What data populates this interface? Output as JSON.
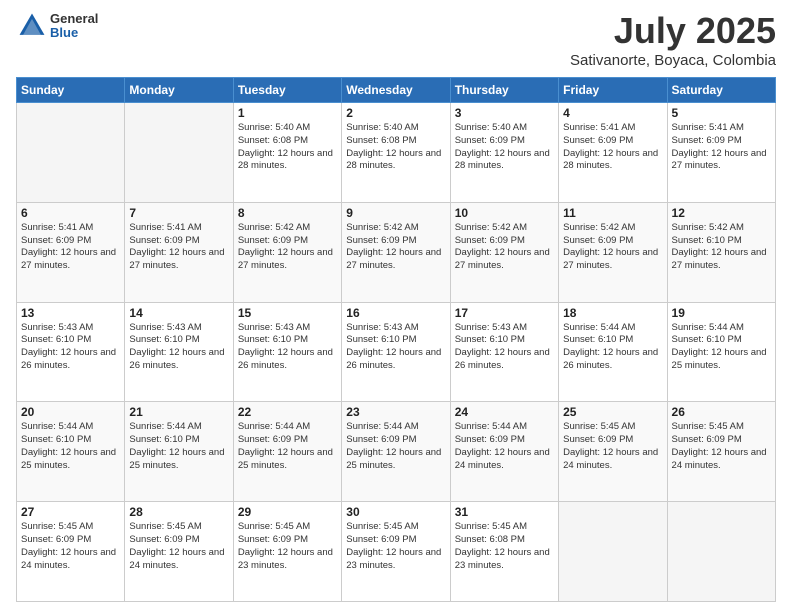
{
  "header": {
    "logo": {
      "general": "General",
      "blue": "Blue"
    },
    "title": "July 2025",
    "subtitle": "Sativanorte, Boyaca, Colombia"
  },
  "weekdays": [
    "Sunday",
    "Monday",
    "Tuesday",
    "Wednesday",
    "Thursday",
    "Friday",
    "Saturday"
  ],
  "weeks": [
    [
      {
        "day": "",
        "empty": true
      },
      {
        "day": "",
        "empty": true
      },
      {
        "day": "1",
        "sunrise": "Sunrise: 5:40 AM",
        "sunset": "Sunset: 6:08 PM",
        "daylight": "Daylight: 12 hours and 28 minutes."
      },
      {
        "day": "2",
        "sunrise": "Sunrise: 5:40 AM",
        "sunset": "Sunset: 6:08 PM",
        "daylight": "Daylight: 12 hours and 28 minutes."
      },
      {
        "day": "3",
        "sunrise": "Sunrise: 5:40 AM",
        "sunset": "Sunset: 6:09 PM",
        "daylight": "Daylight: 12 hours and 28 minutes."
      },
      {
        "day": "4",
        "sunrise": "Sunrise: 5:41 AM",
        "sunset": "Sunset: 6:09 PM",
        "daylight": "Daylight: 12 hours and 28 minutes."
      },
      {
        "day": "5",
        "sunrise": "Sunrise: 5:41 AM",
        "sunset": "Sunset: 6:09 PM",
        "daylight": "Daylight: 12 hours and 27 minutes."
      }
    ],
    [
      {
        "day": "6",
        "sunrise": "Sunrise: 5:41 AM",
        "sunset": "Sunset: 6:09 PM",
        "daylight": "Daylight: 12 hours and 27 minutes."
      },
      {
        "day": "7",
        "sunrise": "Sunrise: 5:41 AM",
        "sunset": "Sunset: 6:09 PM",
        "daylight": "Daylight: 12 hours and 27 minutes."
      },
      {
        "day": "8",
        "sunrise": "Sunrise: 5:42 AM",
        "sunset": "Sunset: 6:09 PM",
        "daylight": "Daylight: 12 hours and 27 minutes."
      },
      {
        "day": "9",
        "sunrise": "Sunrise: 5:42 AM",
        "sunset": "Sunset: 6:09 PM",
        "daylight": "Daylight: 12 hours and 27 minutes."
      },
      {
        "day": "10",
        "sunrise": "Sunrise: 5:42 AM",
        "sunset": "Sunset: 6:09 PM",
        "daylight": "Daylight: 12 hours and 27 minutes."
      },
      {
        "day": "11",
        "sunrise": "Sunrise: 5:42 AM",
        "sunset": "Sunset: 6:09 PM",
        "daylight": "Daylight: 12 hours and 27 minutes."
      },
      {
        "day": "12",
        "sunrise": "Sunrise: 5:42 AM",
        "sunset": "Sunset: 6:10 PM",
        "daylight": "Daylight: 12 hours and 27 minutes."
      }
    ],
    [
      {
        "day": "13",
        "sunrise": "Sunrise: 5:43 AM",
        "sunset": "Sunset: 6:10 PM",
        "daylight": "Daylight: 12 hours and 26 minutes."
      },
      {
        "day": "14",
        "sunrise": "Sunrise: 5:43 AM",
        "sunset": "Sunset: 6:10 PM",
        "daylight": "Daylight: 12 hours and 26 minutes."
      },
      {
        "day": "15",
        "sunrise": "Sunrise: 5:43 AM",
        "sunset": "Sunset: 6:10 PM",
        "daylight": "Daylight: 12 hours and 26 minutes."
      },
      {
        "day": "16",
        "sunrise": "Sunrise: 5:43 AM",
        "sunset": "Sunset: 6:10 PM",
        "daylight": "Daylight: 12 hours and 26 minutes."
      },
      {
        "day": "17",
        "sunrise": "Sunrise: 5:43 AM",
        "sunset": "Sunset: 6:10 PM",
        "daylight": "Daylight: 12 hours and 26 minutes."
      },
      {
        "day": "18",
        "sunrise": "Sunrise: 5:44 AM",
        "sunset": "Sunset: 6:10 PM",
        "daylight": "Daylight: 12 hours and 26 minutes."
      },
      {
        "day": "19",
        "sunrise": "Sunrise: 5:44 AM",
        "sunset": "Sunset: 6:10 PM",
        "daylight": "Daylight: 12 hours and 25 minutes."
      }
    ],
    [
      {
        "day": "20",
        "sunrise": "Sunrise: 5:44 AM",
        "sunset": "Sunset: 6:10 PM",
        "daylight": "Daylight: 12 hours and 25 minutes."
      },
      {
        "day": "21",
        "sunrise": "Sunrise: 5:44 AM",
        "sunset": "Sunset: 6:10 PM",
        "daylight": "Daylight: 12 hours and 25 minutes."
      },
      {
        "day": "22",
        "sunrise": "Sunrise: 5:44 AM",
        "sunset": "Sunset: 6:09 PM",
        "daylight": "Daylight: 12 hours and 25 minutes."
      },
      {
        "day": "23",
        "sunrise": "Sunrise: 5:44 AM",
        "sunset": "Sunset: 6:09 PM",
        "daylight": "Daylight: 12 hours and 25 minutes."
      },
      {
        "day": "24",
        "sunrise": "Sunrise: 5:44 AM",
        "sunset": "Sunset: 6:09 PM",
        "daylight": "Daylight: 12 hours and 24 minutes."
      },
      {
        "day": "25",
        "sunrise": "Sunrise: 5:45 AM",
        "sunset": "Sunset: 6:09 PM",
        "daylight": "Daylight: 12 hours and 24 minutes."
      },
      {
        "day": "26",
        "sunrise": "Sunrise: 5:45 AM",
        "sunset": "Sunset: 6:09 PM",
        "daylight": "Daylight: 12 hours and 24 minutes."
      }
    ],
    [
      {
        "day": "27",
        "sunrise": "Sunrise: 5:45 AM",
        "sunset": "Sunset: 6:09 PM",
        "daylight": "Daylight: 12 hours and 24 minutes."
      },
      {
        "day": "28",
        "sunrise": "Sunrise: 5:45 AM",
        "sunset": "Sunset: 6:09 PM",
        "daylight": "Daylight: 12 hours and 24 minutes."
      },
      {
        "day": "29",
        "sunrise": "Sunrise: 5:45 AM",
        "sunset": "Sunset: 6:09 PM",
        "daylight": "Daylight: 12 hours and 23 minutes."
      },
      {
        "day": "30",
        "sunrise": "Sunrise: 5:45 AM",
        "sunset": "Sunset: 6:09 PM",
        "daylight": "Daylight: 12 hours and 23 minutes."
      },
      {
        "day": "31",
        "sunrise": "Sunrise: 5:45 AM",
        "sunset": "Sunset: 6:08 PM",
        "daylight": "Daylight: 12 hours and 23 minutes."
      },
      {
        "day": "",
        "empty": true
      },
      {
        "day": "",
        "empty": true
      }
    ]
  ]
}
